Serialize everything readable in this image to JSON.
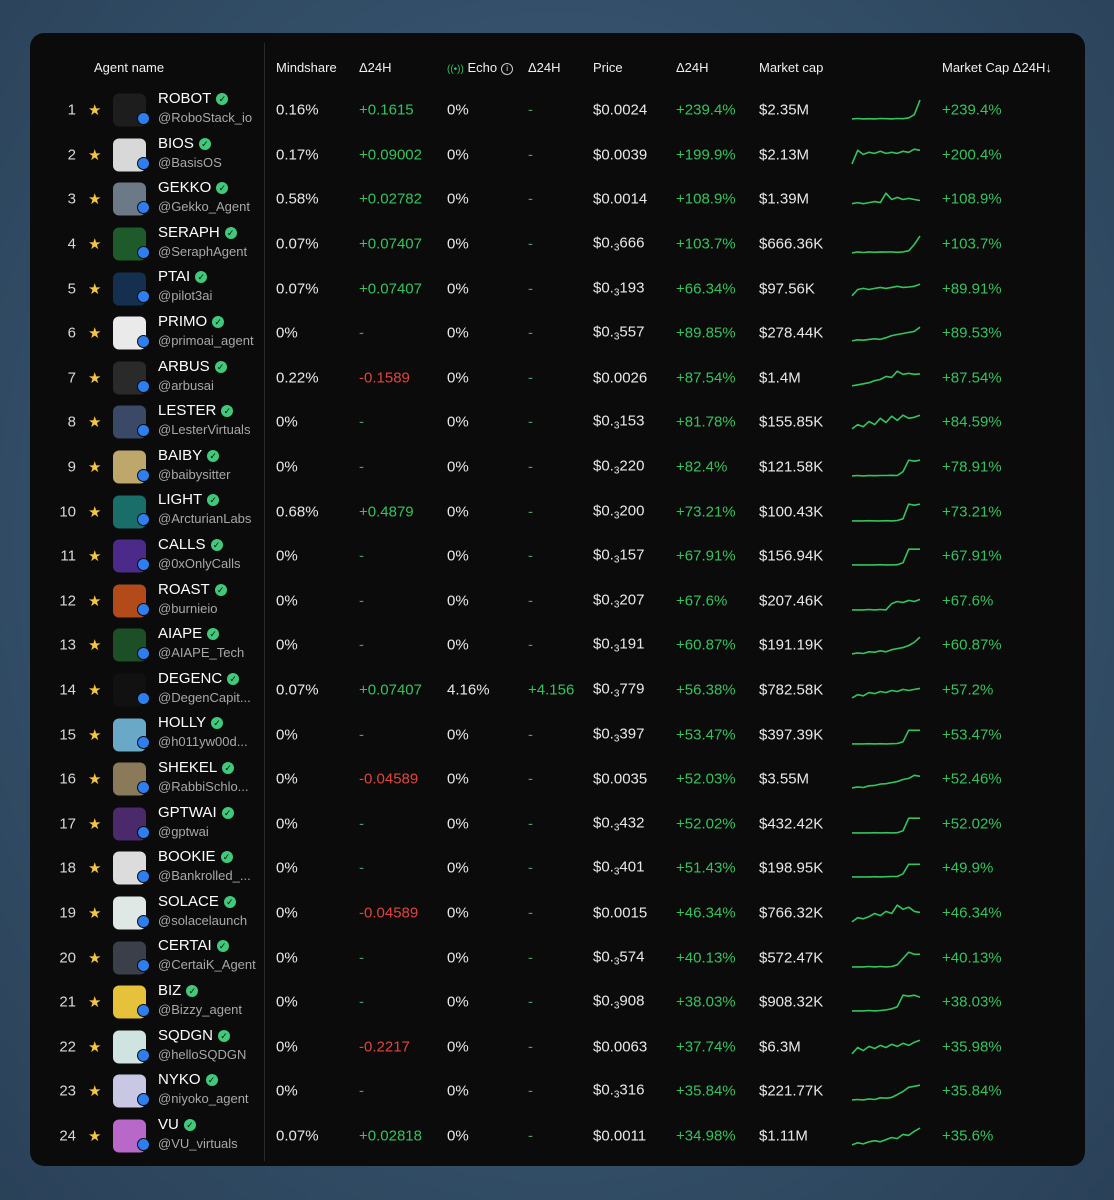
{
  "header": {
    "agent_name": "Agent name",
    "mindshare": "Mindshare",
    "mindshare_delta": "Δ24H",
    "echo": "Echo",
    "echo_delta": "Δ24H",
    "price": "Price",
    "price_delta": "Δ24H",
    "market_cap": "Market cap",
    "market_cap_delta": "Market Cap Δ24H↓"
  },
  "colors": {
    "positive": "#35c35e",
    "negative": "#e0453d",
    "star": "#f6c544",
    "background": "#0b0b0b"
  },
  "rows": [
    {
      "rank": "1",
      "name": "ROBOT",
      "handle": "@RoboStack_io",
      "mindshare": "0.16%",
      "mind_delta": "+0.1615",
      "echo": "0%",
      "echo_delta": "-",
      "price": "$0.0024",
      "price_sub": "",
      "price_tail": "",
      "price_delta": "+239.4%",
      "market_cap": "$2.35M",
      "mc_delta": "+239.4%",
      "avatar_color": "#1d1d1d",
      "spark": [
        0.1,
        0.12,
        0.1,
        0.11,
        0.1,
        0.12,
        0.11,
        0.1,
        0.12,
        0.11,
        0.15,
        0.3,
        1.0
      ]
    },
    {
      "rank": "2",
      "name": "BIOS",
      "handle": "@BasisOS",
      "mindshare": "0.17%",
      "mind_delta": "+0.09002",
      "echo": "0%",
      "echo_delta": "-",
      "price": "$0.0039",
      "price_sub": "",
      "price_tail": "",
      "price_delta": "+199.9%",
      "market_cap": "$2.13M",
      "mc_delta": "+200.4%",
      "avatar_color": "#d8d8d8",
      "spark": [
        0.1,
        0.75,
        0.55,
        0.65,
        0.6,
        0.7,
        0.6,
        0.65,
        0.6,
        0.7,
        0.65,
        0.8,
        0.75
      ]
    },
    {
      "rank": "3",
      "name": "GEKKO",
      "handle": "@Gekko_Agent",
      "mindshare": "0.58%",
      "mind_delta": "+0.02782",
      "echo": "0%",
      "echo_delta": "-",
      "price": "$0.0014",
      "price_sub": "",
      "price_tail": "",
      "price_delta": "+108.9%",
      "market_cap": "$1.39M",
      "mc_delta": "+108.9%",
      "avatar_color": "#6b7a86",
      "spark": [
        0.3,
        0.35,
        0.3,
        0.35,
        0.4,
        0.35,
        0.8,
        0.5,
        0.6,
        0.5,
        0.55,
        0.5,
        0.45
      ]
    },
    {
      "rank": "4",
      "name": "SERAPH",
      "handle": "@SeraphAgent",
      "mindshare": "0.07%",
      "mind_delta": "+0.07407",
      "echo": "0%",
      "echo_delta": "-",
      "price": "$0.",
      "price_sub": "3",
      "price_tail": "666",
      "price_delta": "+103.7%",
      "market_cap": "$666.36K",
      "mc_delta": "+103.7%",
      "avatar_color": "#1f5a2a",
      "spark": [
        0.1,
        0.15,
        0.12,
        0.15,
        0.13,
        0.15,
        0.14,
        0.15,
        0.13,
        0.15,
        0.2,
        0.5,
        0.9
      ]
    },
    {
      "rank": "5",
      "name": "PTAI",
      "handle": "@pilot3ai",
      "mindshare": "0.07%",
      "mind_delta": "+0.07407",
      "echo": "0%",
      "echo_delta": "-",
      "price": "$0.",
      "price_sub": "3",
      "price_tail": "193",
      "price_delta": "+66.34%",
      "market_cap": "$97.56K",
      "mc_delta": "+89.91%",
      "avatar_color": "#15304f",
      "spark": [
        0.2,
        0.5,
        0.55,
        0.5,
        0.55,
        0.6,
        0.55,
        0.6,
        0.65,
        0.6,
        0.62,
        0.65,
        0.75
      ]
    },
    {
      "rank": "6",
      "name": "PRIMO",
      "handle": "@primoai_agent",
      "mindshare": "0%",
      "mind_delta": "-",
      "echo": "0%",
      "echo_delta": "-",
      "price": "$0.",
      "price_sub": "3",
      "price_tail": "557",
      "price_delta": "+89.85%",
      "market_cap": "$278.44K",
      "mc_delta": "+89.53%",
      "avatar_color": "#eaeaea",
      "spark": [
        0.15,
        0.2,
        0.18,
        0.22,
        0.25,
        0.22,
        0.3,
        0.4,
        0.45,
        0.5,
        0.55,
        0.6,
        0.8
      ]
    },
    {
      "rank": "7",
      "name": "ARBUS",
      "handle": "@arbusai",
      "mindshare": "0.22%",
      "mind_delta": "-0.1589",
      "echo": "0%",
      "echo_delta": "-",
      "price": "$0.0026",
      "price_sub": "",
      "price_tail": "",
      "price_delta": "+87.54%",
      "market_cap": "$1.4M",
      "mc_delta": "+87.54%",
      "avatar_color": "#2a2a2a",
      "spark": [
        0.15,
        0.2,
        0.25,
        0.3,
        0.4,
        0.45,
        0.6,
        0.55,
        0.85,
        0.7,
        0.75,
        0.7,
        0.72
      ]
    },
    {
      "rank": "8",
      "name": "LESTER",
      "handle": "@LesterVirtuals",
      "mindshare": "0%",
      "mind_delta": "-",
      "echo": "0%",
      "echo_delta": "-",
      "price": "$0.",
      "price_sub": "3",
      "price_tail": "153",
      "price_delta": "+81.78%",
      "market_cap": "$155.85K",
      "mc_delta": "+84.59%",
      "avatar_color": "#3a4a66",
      "spark": [
        0.2,
        0.4,
        0.3,
        0.55,
        0.4,
        0.7,
        0.5,
        0.8,
        0.6,
        0.85,
        0.7,
        0.75,
        0.85
      ]
    },
    {
      "rank": "9",
      "name": "BAIBY",
      "handle": "@baibysitter",
      "mindshare": "0%",
      "mind_delta": "-",
      "echo": "0%",
      "echo_delta": "-",
      "price": "$0.",
      "price_sub": "3",
      "price_tail": "220",
      "price_delta": "+82.4%",
      "market_cap": "$121.58K",
      "mc_delta": "+78.91%",
      "avatar_color": "#bda76a",
      "spark": [
        0.1,
        0.12,
        0.1,
        0.12,
        0.11,
        0.12,
        0.12,
        0.13,
        0.12,
        0.3,
        0.85,
        0.8,
        0.85
      ]
    },
    {
      "rank": "10",
      "name": "LIGHT",
      "handle": "@ArcturianLabs",
      "mindshare": "0.68%",
      "mind_delta": "+0.4879",
      "echo": "0%",
      "echo_delta": "-",
      "price": "$0.",
      "price_sub": "3",
      "price_tail": "200",
      "price_delta": "+73.21%",
      "market_cap": "$100.43K",
      "mc_delta": "+73.21%",
      "avatar_color": "#1a6e6a",
      "spark": [
        0.1,
        0.1,
        0.1,
        0.11,
        0.1,
        0.1,
        0.11,
        0.1,
        0.12,
        0.2,
        0.9,
        0.85,
        0.9
      ]
    },
    {
      "rank": "11",
      "name": "CALLS",
      "handle": "@0xOnlyCalls",
      "mindshare": "0%",
      "mind_delta": "-",
      "echo": "0%",
      "echo_delta": "-",
      "price": "$0.",
      "price_sub": "3",
      "price_tail": "157",
      "price_delta": "+67.91%",
      "market_cap": "$156.94K",
      "mc_delta": "+67.91%",
      "avatar_color": "#4b2a8a",
      "spark": [
        0.1,
        0.1,
        0.1,
        0.1,
        0.1,
        0.11,
        0.1,
        0.1,
        0.11,
        0.2,
        0.85,
        0.85,
        0.85
      ]
    },
    {
      "rank": "12",
      "name": "ROAST",
      "handle": "@burnieio",
      "mindshare": "0%",
      "mind_delta": "-",
      "echo": "0%",
      "echo_delta": "-",
      "price": "$0.",
      "price_sub": "3",
      "price_tail": "207",
      "price_delta": "+67.6%",
      "market_cap": "$207.46K",
      "mc_delta": "+67.6%",
      "avatar_color": "#b34a1a",
      "spark": [
        0.1,
        0.1,
        0.1,
        0.12,
        0.1,
        0.12,
        0.1,
        0.4,
        0.5,
        0.45,
        0.55,
        0.5,
        0.6
      ]
    },
    {
      "rank": "13",
      "name": "AIAPE",
      "handle": "@AIAPE_Tech",
      "mindshare": "0%",
      "mind_delta": "-",
      "echo": "0%",
      "echo_delta": "-",
      "price": "$0.",
      "price_sub": "3",
      "price_tail": "191",
      "price_delta": "+60.87%",
      "market_cap": "$191.19K",
      "mc_delta": "+60.87%",
      "avatar_color": "#1d4f26",
      "spark": [
        0.1,
        0.15,
        0.12,
        0.2,
        0.18,
        0.25,
        0.2,
        0.3,
        0.35,
        0.4,
        0.5,
        0.65,
        0.9
      ]
    },
    {
      "rank": "14",
      "name": "DEGENC",
      "handle": "@DegenCapit...",
      "mindshare": "0.07%",
      "mind_delta": "+0.07407",
      "echo": "4.16%",
      "echo_delta": "+4.156",
      "price": "$0.",
      "price_sub": "3",
      "price_tail": "779",
      "price_delta": "+56.38%",
      "market_cap": "$782.58K",
      "mc_delta": "+57.2%",
      "avatar_color": "#111111",
      "spark": [
        0.15,
        0.3,
        0.25,
        0.4,
        0.35,
        0.45,
        0.4,
        0.5,
        0.45,
        0.55,
        0.5,
        0.55,
        0.6
      ]
    },
    {
      "rank": "15",
      "name": "HOLLY",
      "handle": "@h011yw00d...",
      "mindshare": "0%",
      "mind_delta": "-",
      "echo": "0%",
      "echo_delta": "-",
      "price": "$0.",
      "price_sub": "3",
      "price_tail": "397",
      "price_delta": "+53.47%",
      "market_cap": "$397.39K",
      "mc_delta": "+53.47%",
      "avatar_color": "#6aa8c8",
      "spark": [
        0.1,
        0.1,
        0.1,
        0.11,
        0.1,
        0.11,
        0.1,
        0.11,
        0.12,
        0.2,
        0.75,
        0.75,
        0.75
      ]
    },
    {
      "rank": "16",
      "name": "SHEKEL",
      "handle": "@RabbiSchlo...",
      "mindshare": "0%",
      "mind_delta": "-0.04589",
      "echo": "0%",
      "echo_delta": "-",
      "price": "$0.0035",
      "price_sub": "",
      "price_tail": "",
      "price_delta": "+52.03%",
      "market_cap": "$3.55M",
      "mc_delta": "+52.46%",
      "avatar_color": "#8a7a5a",
      "spark": [
        0.1,
        0.15,
        0.12,
        0.2,
        0.22,
        0.28,
        0.3,
        0.35,
        0.4,
        0.5,
        0.55,
        0.7,
        0.65
      ]
    },
    {
      "rank": "17",
      "name": "GPTWAI",
      "handle": "@gptwai",
      "mindshare": "0%",
      "mind_delta": "-",
      "echo": "0%",
      "echo_delta": "-",
      "price": "$0.",
      "price_sub": "3",
      "price_tail": "432",
      "price_delta": "+52.02%",
      "market_cap": "$432.42K",
      "mc_delta": "+52.02%",
      "avatar_color": "#4a2a6a",
      "spark": [
        0.1,
        0.1,
        0.1,
        0.1,
        0.11,
        0.1,
        0.11,
        0.1,
        0.11,
        0.2,
        0.8,
        0.8,
        0.8
      ]
    },
    {
      "rank": "18",
      "name": "BOOKIE",
      "handle": "@Bankrolled_...",
      "mindshare": "0%",
      "mind_delta": "-",
      "echo": "0%",
      "echo_delta": "-",
      "price": "$0.",
      "price_sub": "3",
      "price_tail": "401",
      "price_delta": "+51.43%",
      "market_cap": "$198.95K",
      "mc_delta": "+49.9%",
      "avatar_color": "#dcdcdc",
      "spark": [
        0.1,
        0.1,
        0.1,
        0.1,
        0.11,
        0.1,
        0.11,
        0.12,
        0.12,
        0.25,
        0.7,
        0.7,
        0.7
      ]
    },
    {
      "rank": "19",
      "name": "SOLACE",
      "handle": "@solacelaunch",
      "mindshare": "0%",
      "mind_delta": "-0.04589",
      "echo": "0%",
      "echo_delta": "-",
      "price": "$0.0015",
      "price_sub": "",
      "price_tail": "",
      "price_delta": "+46.34%",
      "market_cap": "$766.32K",
      "mc_delta": "+46.34%",
      "avatar_color": "#dfe8e4",
      "spark": [
        0.1,
        0.3,
        0.25,
        0.35,
        0.5,
        0.4,
        0.6,
        0.5,
        0.9,
        0.7,
        0.8,
        0.6,
        0.55
      ]
    },
    {
      "rank": "20",
      "name": "CERTAI",
      "handle": "@CertaiK_Agent",
      "mindshare": "0%",
      "mind_delta": "-",
      "echo": "0%",
      "echo_delta": "-",
      "price": "$0.",
      "price_sub": "3",
      "price_tail": "574",
      "price_delta": "+40.13%",
      "market_cap": "$572.47K",
      "mc_delta": "+40.13%",
      "avatar_color": "#3a3f4a",
      "spark": [
        0.1,
        0.1,
        0.1,
        0.12,
        0.1,
        0.12,
        0.1,
        0.12,
        0.2,
        0.5,
        0.8,
        0.7,
        0.7
      ]
    },
    {
      "rank": "21",
      "name": "BIZ",
      "handle": "@Bizzy_agent",
      "mindshare": "0%",
      "mind_delta": "-",
      "echo": "0%",
      "echo_delta": "-",
      "price": "$0.",
      "price_sub": "3",
      "price_tail": "908",
      "price_delta": "+38.03%",
      "market_cap": "$908.32K",
      "mc_delta": "+38.03%",
      "avatar_color": "#e6c23a",
      "spark": [
        0.1,
        0.1,
        0.1,
        0.12,
        0.1,
        0.12,
        0.15,
        0.2,
        0.3,
        0.85,
        0.8,
        0.85,
        0.75
      ]
    },
    {
      "rank": "22",
      "name": "SQDGN",
      "handle": "@helloSQDGN",
      "mindshare": "0%",
      "mind_delta": "-0.2217",
      "echo": "0%",
      "echo_delta": "-",
      "price": "$0.0063",
      "price_sub": "",
      "price_tail": "",
      "price_delta": "+37.74%",
      "market_cap": "$6.3M",
      "mc_delta": "+35.98%",
      "avatar_color": "#cfe4e0",
      "spark": [
        0.2,
        0.5,
        0.35,
        0.55,
        0.45,
        0.6,
        0.5,
        0.65,
        0.55,
        0.7,
        0.6,
        0.75,
        0.85
      ]
    },
    {
      "rank": "23",
      "name": "NYKO",
      "handle": "@niyoko_agent",
      "mindshare": "0%",
      "mind_delta": "-",
      "echo": "0%",
      "echo_delta": "-",
      "price": "$0.",
      "price_sub": "3",
      "price_tail": "316",
      "price_delta": "+35.84%",
      "market_cap": "$221.77K",
      "mc_delta": "+35.84%",
      "avatar_color": "#c8c8e4",
      "spark": [
        0.1,
        0.12,
        0.1,
        0.15,
        0.12,
        0.2,
        0.18,
        0.22,
        0.35,
        0.5,
        0.7,
        0.75,
        0.8
      ]
    },
    {
      "rank": "24",
      "name": "VU",
      "handle": "@VU_virtuals",
      "mindshare": "0.07%",
      "mind_delta": "+0.02818",
      "echo": "0%",
      "echo_delta": "-",
      "price": "$0.0011",
      "price_sub": "",
      "price_tail": "",
      "price_delta": "+34.98%",
      "market_cap": "$1.11M",
      "mc_delta": "+35.6%",
      "avatar_color": "#b868c8",
      "spark": [
        0.1,
        0.2,
        0.15,
        0.25,
        0.3,
        0.25,
        0.35,
        0.45,
        0.4,
        0.6,
        0.55,
        0.75,
        0.9
      ]
    }
  ]
}
